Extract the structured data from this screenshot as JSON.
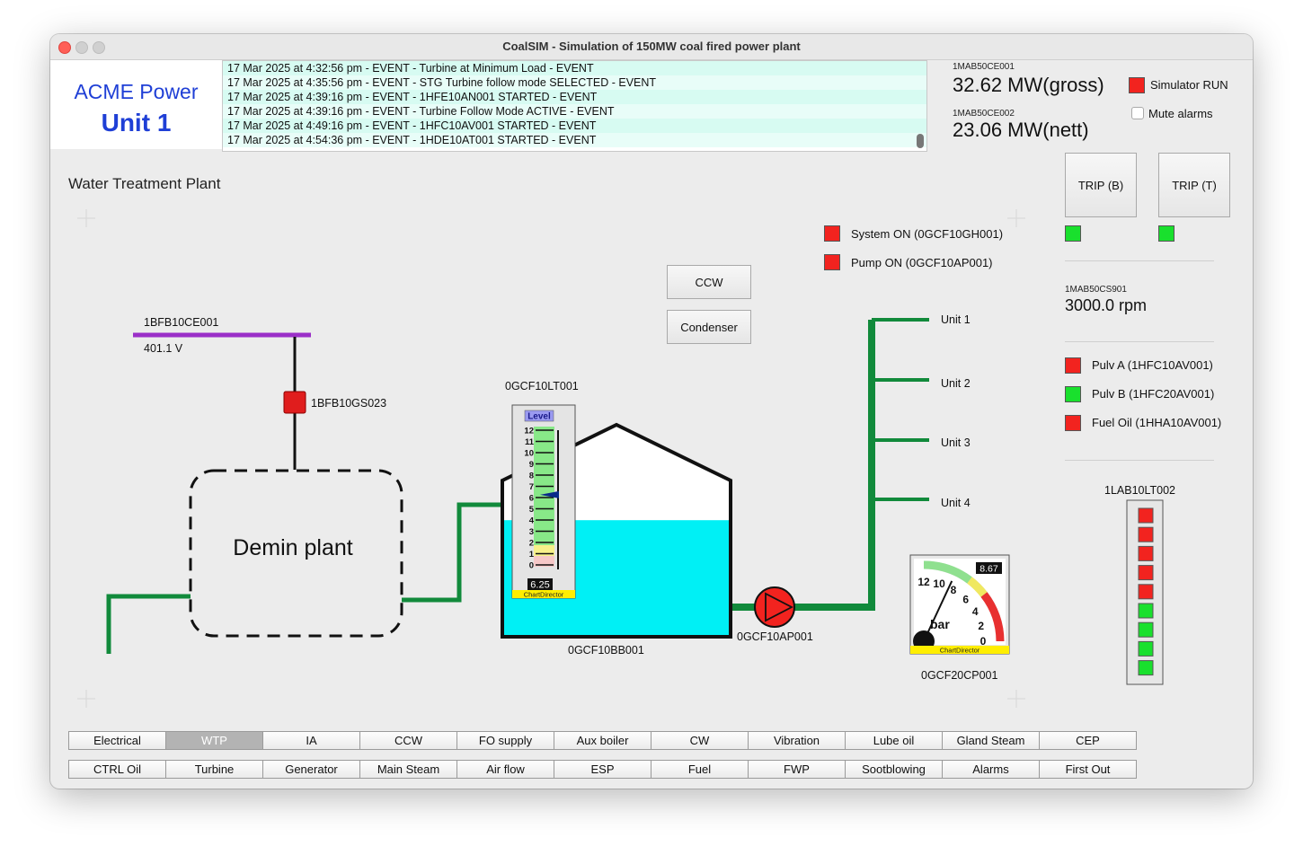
{
  "window": {
    "title": "CoalSIM - Simulation of 150MW coal fired power plant"
  },
  "brand": {
    "line1": "ACME Power",
    "line2": "Unit 1"
  },
  "event_log": [
    "17 Mar 2025 at 4:32:56 pm - EVENT - Turbine at Minimum Load - EVENT",
    "17 Mar 2025 at 4:35:56 pm - EVENT - STG Turbine follow mode SELECTED - EVENT",
    "17 Mar 2025 at 4:39:16 pm - EVENT - 1HFE10AN001 STARTED - EVENT",
    "17 Mar 2025 at 4:39:16 pm - EVENT - Turbine Follow Mode ACTIVE - EVENT",
    "17 Mar 2025 at 4:49:16 pm - EVENT - 1HFC10AV001 STARTED - EVENT",
    "17 Mar 2025 at 4:54:36 pm - EVENT - 1HDE10AT001 STARTED - EVENT"
  ],
  "metrics": {
    "gross_tag": "1MAB50CE001",
    "gross_value": "32.62 MW(gross)",
    "nett_tag": "1MAB50CE002",
    "nett_value": "23.06 MW(nett)",
    "speed_tag": "1MAB50CS901",
    "speed_value": "3000.0 rpm"
  },
  "simulator": {
    "run_label": "Simulator RUN",
    "mute_label": "Mute alarms",
    "mute_checked": false
  },
  "trip_buttons": {
    "boiler": "TRIP (B)",
    "turbine": "TRIP (T)"
  },
  "status_indicators": [
    {
      "label": "System ON (0GCF10GH001)",
      "state": "red"
    },
    {
      "label": "Pump ON (0GCF10AP001)",
      "state": "red"
    }
  ],
  "equipment_status": [
    {
      "label": "Pulv A (1HFC10AV001)",
      "state": "red"
    },
    {
      "label": "Pulv B (1HFC20AV001)",
      "state": "green"
    },
    {
      "label": "Fuel Oil (1HHA10AV001)",
      "state": "red"
    }
  ],
  "panel_title": "Water Treatment Plant",
  "nav_buttons": {
    "ccw": "CCW",
    "condenser": "Condenser"
  },
  "plant": {
    "bus_tag": "1BFB10CE001",
    "bus_voltage": "401.1 V",
    "breaker_tag": "1BFB10GS023",
    "demin_label": "Demin plant",
    "level_tag": "0GCF10LT001",
    "tank_tag": "0GCF10BB001",
    "pump_tag": "0GCF10AP001",
    "pressure_tag": "0GCF20CP001",
    "unit_labels": [
      "Unit 1",
      "Unit 2",
      "Unit 3",
      "Unit 4"
    ],
    "tank_level_fraction": 0.55
  },
  "level_gauge": {
    "title": "Level",
    "ticks": [
      "12",
      "11",
      "10",
      "9",
      "8",
      "7",
      "6",
      "5",
      "4",
      "3",
      "2",
      "1",
      "0"
    ],
    "value": 6.25,
    "value_text": "6.25",
    "max": 12,
    "footer": "ChartDirector"
  },
  "pressure_gauge": {
    "value": 8.67,
    "value_text": "8.67",
    "unit": "bar",
    "ticks": [
      "12",
      "10",
      "8",
      "6",
      "4",
      "2",
      "0"
    ],
    "max": 12,
    "footer": "ChartDirector"
  },
  "lab_level": {
    "tag": "1LAB10LT002",
    "leds": [
      "red",
      "red",
      "red",
      "red",
      "red",
      "green",
      "green",
      "green",
      "green"
    ]
  },
  "tabs_row1": [
    "Electrical",
    "WTP",
    "IA",
    "CCW",
    "FO supply",
    "Aux boiler",
    "CW",
    "Vibration",
    "Lube oil",
    "Gland Steam",
    "CEP"
  ],
  "tabs_row2": [
    "CTRL Oil",
    "Turbine",
    "Generator",
    "Main Steam",
    "Air flow",
    "ESP",
    "Fuel",
    "FWP",
    "Sootblowing",
    "Alarms",
    "First Out"
  ],
  "active_tab": "WTP",
  "colors": {
    "pipe": "#118a3b",
    "bus": "#9b2fc8",
    "water": "#00f0f5",
    "brand": "#1f3fd6",
    "alarm_red": "#f2231f",
    "ok_green": "#19e02d"
  }
}
